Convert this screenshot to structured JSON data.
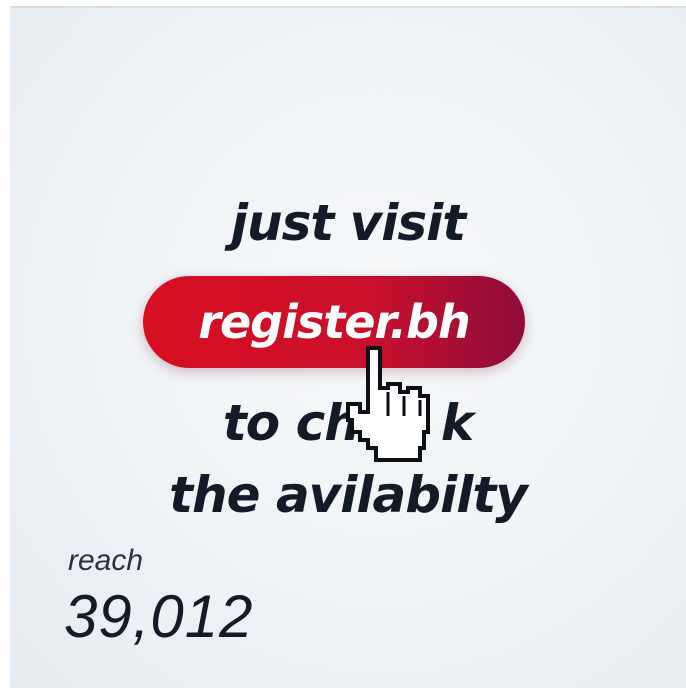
{
  "post": {
    "line1": "just visit",
    "url_button_label": "register.bh",
    "line3": "to ch     k",
    "line4": "the avilabilty"
  },
  "stats": {
    "reach_label": "reach",
    "reach_value": "39,012"
  },
  "colors": {
    "button_start": "#d70f21",
    "button_end": "#8d0d3a",
    "text_dark": "#141b28"
  },
  "icons": {
    "cursor": "hand-pointer-icon"
  }
}
